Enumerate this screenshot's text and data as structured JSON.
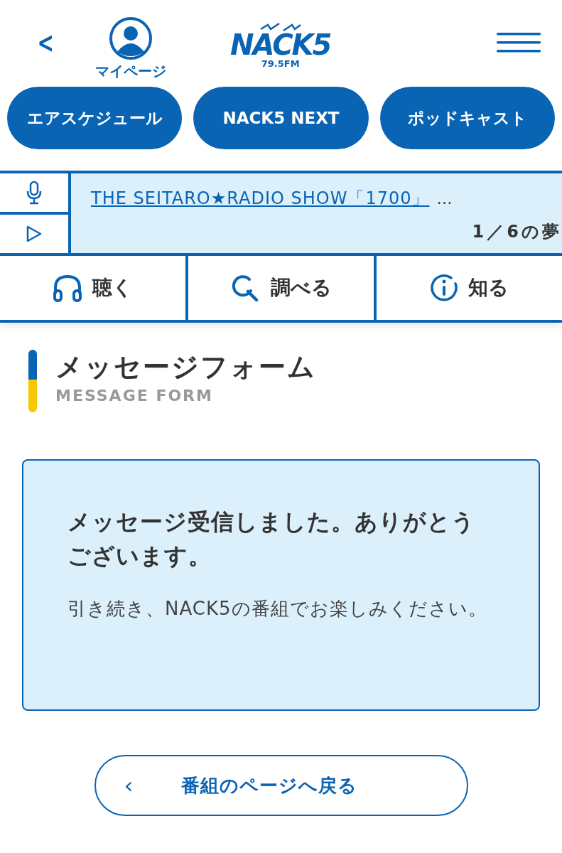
{
  "header": {
    "back": "<",
    "mypage": "マイページ",
    "logo": {
      "name": "NACK5",
      "frequency": "79.5FM"
    }
  },
  "quick_links": [
    "エアスケジュール",
    "NACK5 NEXT",
    "ポッドキャスト"
  ],
  "now_playing": {
    "title": "THE SEITARO★RADIO SHOW「1700」",
    "more": "…",
    "subtitle": "1／6の夢"
  },
  "nav_tabs": [
    {
      "label": "聴く",
      "kind": "headphones"
    },
    {
      "label": "調べる",
      "kind": "search"
    },
    {
      "label": "知る",
      "kind": "info"
    }
  ],
  "page_heading": {
    "title": "メッセージフォーム",
    "subtitle": "MESSAGE FORM"
  },
  "notice": {
    "title": "メッセージ受信しました。ありがとうございます。",
    "body": "引き続き、NACK5の番組でお楽しみください。"
  },
  "back_button": {
    "icon": "‹",
    "label": "番組のページへ戻る"
  }
}
